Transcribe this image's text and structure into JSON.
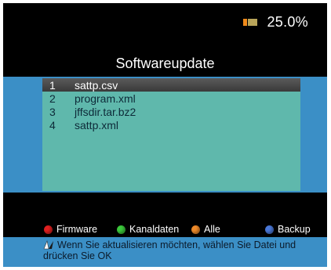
{
  "status": {
    "text": "25.0%",
    "icon": "battery-icon",
    "progress_percent": 25.0
  },
  "title": "Softwareupdate",
  "files": [
    {
      "num": "1",
      "name": "sattp.csv",
      "selected": true
    },
    {
      "num": "2",
      "name": "program.xml",
      "selected": false
    },
    {
      "num": "3",
      "name": "jffsdir.tar.bz2",
      "selected": false
    },
    {
      "num": "4",
      "name": "sattp.xml",
      "selected": false
    }
  ],
  "legend": [
    {
      "label": "Firmware",
      "color": "#e02020",
      "icon": "red-dot-icon"
    },
    {
      "label": "Kanaldaten",
      "color": "#3cc83c",
      "icon": "green-dot-icon"
    },
    {
      "label": "Alle",
      "color": "#ee8a2a",
      "icon": "orange-dot-icon"
    },
    {
      "label": "Backup",
      "color": "#4a78d8",
      "icon": "blue-dot-icon"
    }
  ],
  "help": {
    "icon": "arrow-keys-icon",
    "text": "Wenn Sie aktualisieren möchten, wählen Sie Datei und drücken Sie OK"
  },
  "colors": {
    "band": "#3b8fc6",
    "panel": "#5fb8ac",
    "selection": "#4a4a4a",
    "background": "#000000"
  }
}
